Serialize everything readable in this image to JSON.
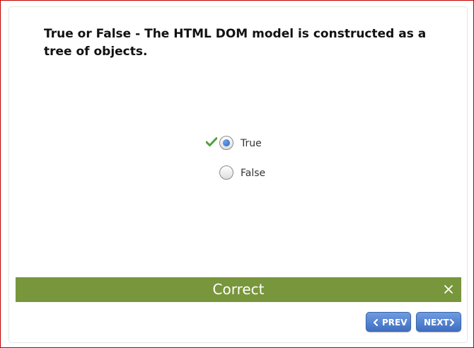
{
  "question": {
    "text": "True or False - The HTML DOM model is constructed as a tree of objects."
  },
  "options": [
    {
      "label": "True",
      "selected": true,
      "marked_correct": true
    },
    {
      "label": "False",
      "selected": false,
      "marked_correct": false
    }
  ],
  "feedback": {
    "text": "Correct",
    "color": "#78963c",
    "close_icon": "close-icon"
  },
  "navigation": {
    "prev_label": "PREV",
    "next_label": "NEXT",
    "button_color": "#4a78c8"
  },
  "icons": {
    "check": "check-icon",
    "prev": "chevron-left-icon",
    "next": "chevron-right-icon"
  }
}
